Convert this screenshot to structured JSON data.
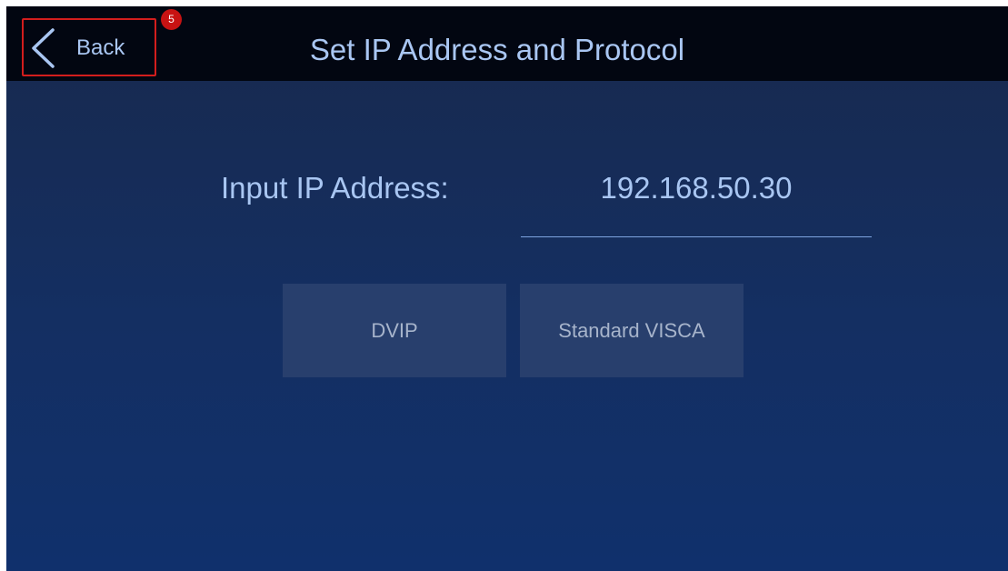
{
  "header": {
    "back_label": "Back",
    "badge_count": "5",
    "title": "Set IP Address and Protocol"
  },
  "form": {
    "ip_label": "Input IP Address:",
    "ip_value": "192.168.50.30"
  },
  "protocols": [
    {
      "label": "DVIP"
    },
    {
      "label": "Standard VISCA"
    }
  ],
  "colors": {
    "text": "#a9c6f2",
    "topbar": "#020611",
    "highlight_border": "#d31d1d",
    "badge": "#c81313",
    "button_bg": "#283f6d",
    "button_text": "#a7b4cb"
  }
}
